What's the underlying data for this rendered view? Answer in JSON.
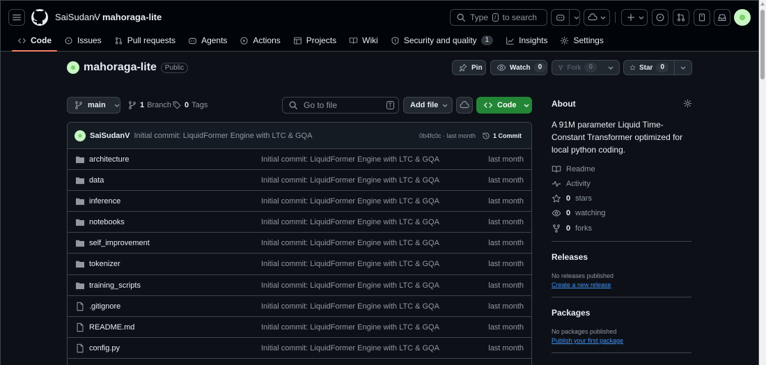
{
  "breadcrumb": {
    "owner": "SaiSudanV",
    "separator": "/",
    "repo": "mahoraga-lite"
  },
  "search": {
    "type_text": "Type",
    "key": "/",
    "rest_text": "to search"
  },
  "tabs": [
    {
      "label": "Code",
      "icon": "code-icon",
      "active": true
    },
    {
      "label": "Issues",
      "icon": "issue-opened-icon"
    },
    {
      "label": "Pull requests",
      "icon": "git-pull-request-icon"
    },
    {
      "label": "Agents",
      "icon": "copilot-icon"
    },
    {
      "label": "Actions",
      "icon": "play-icon"
    },
    {
      "label": "Projects",
      "icon": "table-icon"
    },
    {
      "label": "Wiki",
      "icon": "book-icon"
    },
    {
      "label": "Security and quality",
      "icon": "shield-icon",
      "counter": "1"
    },
    {
      "label": "Insights",
      "icon": "graph-icon"
    },
    {
      "label": "Settings",
      "icon": "gear-icon"
    }
  ],
  "repo": {
    "name": "mahoraga-lite",
    "visibility": "Public"
  },
  "actions": {
    "pin": "Pin",
    "watch": "Watch",
    "watch_count": "0",
    "fork": "Fork",
    "fork_count": "0",
    "star": "Star",
    "star_count": "0"
  },
  "filenav": {
    "branch": "main",
    "branch_count": "1",
    "branch_label": "Branch",
    "tag_count": "0",
    "tag_label": "Tags",
    "goto_placeholder": "Go to file",
    "goto_key": "T",
    "add_file": "Add file",
    "code": "Code"
  },
  "commit": {
    "author": "SaiSudanV",
    "message": "Initial commit: LiquidFormer Engine with LTC & GQA",
    "hash_time": "0b4fc0c · last month",
    "count": "1 Commit"
  },
  "files": [
    {
      "name": "architecture",
      "type": "folder",
      "message": "Initial commit: LiquidFormer Engine with LTC & GQA",
      "date": "last month"
    },
    {
      "name": "data",
      "type": "folder",
      "message": "Initial commit: LiquidFormer Engine with LTC & GQA",
      "date": "last month"
    },
    {
      "name": "inference",
      "type": "folder",
      "message": "Initial commit: LiquidFormer Engine with LTC & GQA",
      "date": "last month"
    },
    {
      "name": "notebooks",
      "type": "folder",
      "message": "Initial commit: LiquidFormer Engine with LTC & GQA",
      "date": "last month"
    },
    {
      "name": "self_improvement",
      "type": "folder",
      "message": "Initial commit: LiquidFormer Engine with LTC & GQA",
      "date": "last month"
    },
    {
      "name": "tokenizer",
      "type": "folder",
      "message": "Initial commit: LiquidFormer Engine with LTC & GQA",
      "date": "last month"
    },
    {
      "name": "training_scripts",
      "type": "folder",
      "message": "Initial commit: LiquidFormer Engine with LTC & GQA",
      "date": "last month"
    },
    {
      "name": ".gitignore",
      "type": "file",
      "message": "Initial commit: LiquidFormer Engine with LTC & GQA",
      "date": "last month"
    },
    {
      "name": "README.md",
      "type": "file",
      "message": "Initial commit: LiquidFormer Engine with LTC & GQA",
      "date": "last month"
    },
    {
      "name": "config.py",
      "type": "file",
      "message": "Initial commit: LiquidFormer Engine with LTC & GQA",
      "date": "last month"
    }
  ],
  "about": {
    "heading": "About",
    "description": "A 91M parameter Liquid Time-Constant Transformer optimized for local python coding.",
    "readme": "Readme",
    "activity": "Activity",
    "stars_count": "0",
    "stars_label": "stars",
    "watching_count": "0",
    "watching_label": "watching",
    "forks_count": "0",
    "forks_label": "forks"
  },
  "releases": {
    "heading": "Releases",
    "empty": "No releases published",
    "link": "Create a new release"
  },
  "packages": {
    "heading": "Packages",
    "empty": "No packages published",
    "link": "Publish your first package"
  },
  "colors": {
    "bg": "#0d1117",
    "header_bg": "#010409",
    "accent_tab": "#f78166",
    "green_button": "#238636",
    "link": "#4493f8"
  }
}
